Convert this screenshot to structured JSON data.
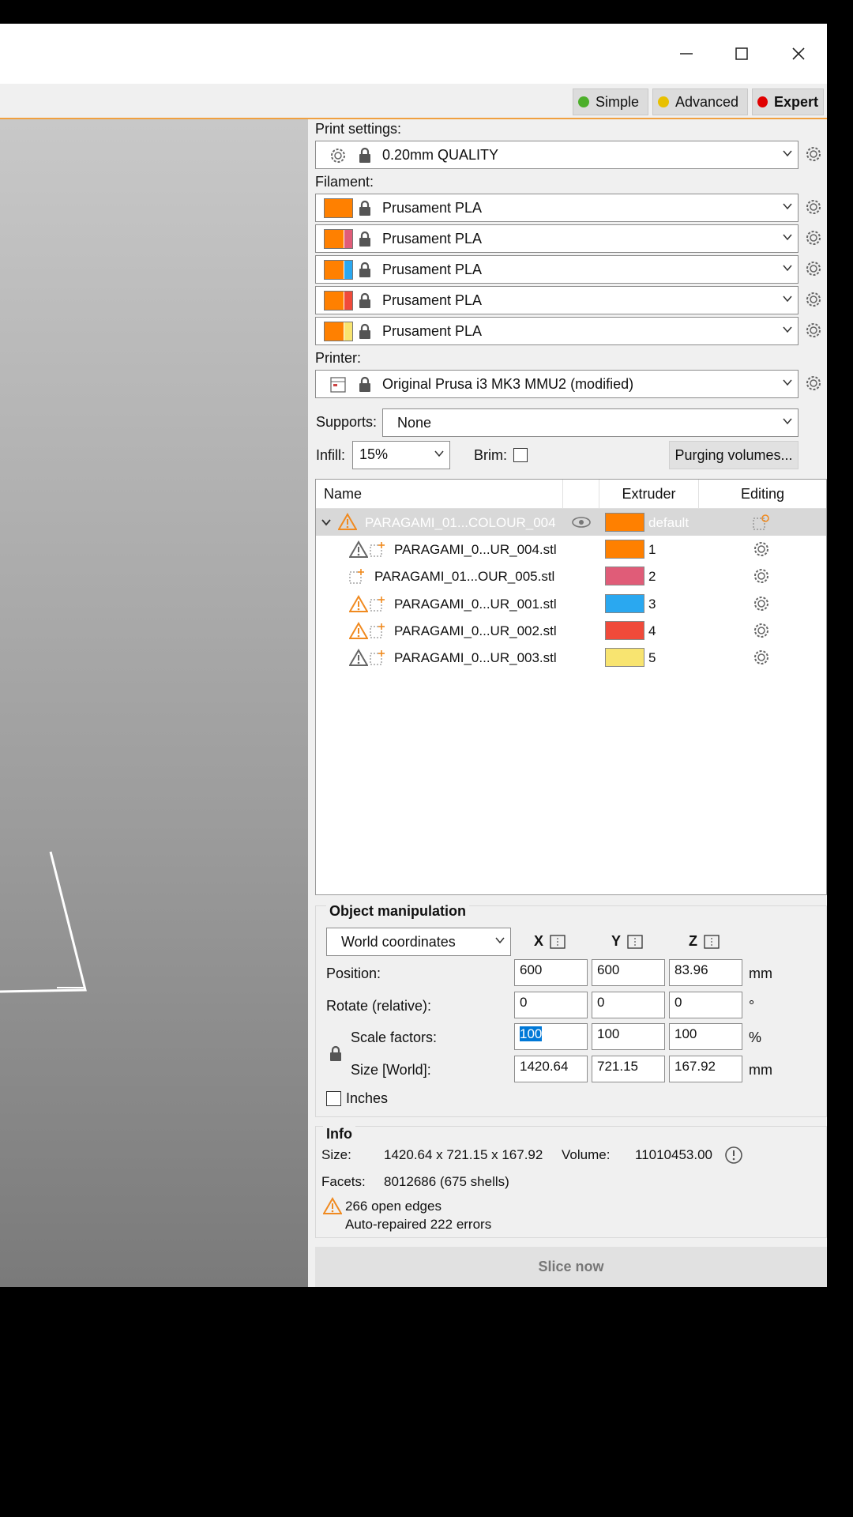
{
  "modes": [
    {
      "label": "Simple",
      "color": "#4caf2a"
    },
    {
      "label": "Advanced",
      "color": "#e8c000"
    },
    {
      "label": "Expert",
      "color": "#e00000"
    }
  ],
  "print_settings": {
    "label": "Print settings:",
    "value": "0.20mm QUALITY"
  },
  "filament": {
    "label": "Filament:",
    "items": [
      {
        "value": "Prusament PLA",
        "colors": [
          "#ff8000"
        ]
      },
      {
        "value": "Prusament PLA",
        "colors": [
          "#ff8000",
          "#e05c78"
        ]
      },
      {
        "value": "Prusament PLA",
        "colors": [
          "#ff8000",
          "#2aa8f0"
        ]
      },
      {
        "value": "Prusament PLA",
        "colors": [
          "#ff8000",
          "#f04a3a"
        ]
      },
      {
        "value": "Prusament PLA",
        "colors": [
          "#ff8000",
          "#f8e470"
        ]
      }
    ]
  },
  "printer": {
    "label": "Printer:",
    "value": "Original Prusa i3 MK3 MMU2 (modified)"
  },
  "supports": {
    "label": "Supports:",
    "value": "None"
  },
  "infill": {
    "label": "Infill:",
    "value": "15%"
  },
  "brim": {
    "label": "Brim:",
    "checked": false
  },
  "purging_button": "Purging volumes...",
  "object_list": {
    "headers": [
      "Name",
      "Extruder",
      "Editing"
    ],
    "parent": {
      "name": "PARAGAMI_01...COLOUR_004",
      "extruder": "default",
      "color": "#ff8000"
    },
    "rows": [
      {
        "name": "PARAGAMI_0...UR_004.stl",
        "extruder": "1",
        "color": "#ff8000",
        "warning": "grey"
      },
      {
        "name": "PARAGAMI_01...OUR_005.stl",
        "extruder": "2",
        "color": "#e05c78",
        "warning": "none"
      },
      {
        "name": "PARAGAMI_0...UR_001.stl",
        "extruder": "3",
        "color": "#2aa8f0",
        "warning": "orange"
      },
      {
        "name": "PARAGAMI_0...UR_002.stl",
        "extruder": "4",
        "color": "#f04a3a",
        "warning": "orange"
      },
      {
        "name": "PARAGAMI_0...UR_003.stl",
        "extruder": "5",
        "color": "#f8e470",
        "warning": "grey"
      }
    ]
  },
  "object_manipulation": {
    "title": "Object manipulation",
    "coord_system": "World coordinates",
    "axes": [
      "X",
      "Y",
      "Z"
    ],
    "rows": [
      {
        "label": "Position:",
        "values": [
          "600",
          "600",
          "83.96"
        ],
        "unit": "mm"
      },
      {
        "label": "Rotate (relative):",
        "values": [
          "0",
          "0",
          "0"
        ],
        "unit": "°"
      },
      {
        "label": "Scale factors:",
        "values": [
          "100",
          "100",
          "100"
        ],
        "unit": "%"
      },
      {
        "label": "Size [World]:",
        "values": [
          "1420.64",
          "721.15",
          "167.92"
        ],
        "unit": "mm"
      }
    ],
    "inches_label": "Inches"
  },
  "info": {
    "title": "Info",
    "size_label": "Size:",
    "size_value": "1420.64 x 721.15 x 167.92",
    "volume_label": "Volume:",
    "volume_value": "11010453.00",
    "facets_label": "Facets:",
    "facets_value": "8012686 (675 shells)",
    "warning_line1": "266 open edges",
    "warning_line2": "Auto-repaired 222 errors"
  },
  "slice_button": "Slice now"
}
